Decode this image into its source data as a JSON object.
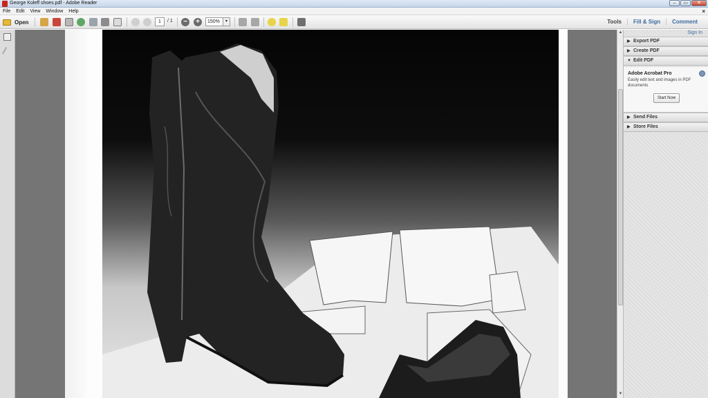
{
  "window": {
    "title": "George Koleff shoes.pdf - Adobe Reader",
    "controls": {
      "minimize": "–",
      "maximize": "▭",
      "close": "✕"
    }
  },
  "menubar": {
    "items": [
      "File",
      "Edit",
      "View",
      "Window",
      "Help"
    ],
    "close_doc": "×"
  },
  "toolbar": {
    "open_label": "Open",
    "page_current": "1",
    "page_total": "/ 1",
    "zoom_value": "150%",
    "zoom_dropdown": "▾",
    "zoom_out": "−",
    "zoom_in": "+",
    "right_links": [
      "Tools",
      "Fill & Sign",
      "Comment"
    ]
  },
  "right_pane": {
    "sign_in": "Sign In",
    "panels": [
      {
        "label": "Export PDF",
        "state": "collapsed",
        "arrow": "▶"
      },
      {
        "label": "Create PDF",
        "state": "collapsed",
        "arrow": "▶"
      },
      {
        "label": "Edit PDF",
        "state": "expanded",
        "arrow": "▼"
      },
      {
        "label": "Send Files",
        "state": "collapsed",
        "arrow": "▶"
      },
      {
        "label": "Store Files",
        "state": "collapsed",
        "arrow": "▶"
      }
    ],
    "edit_pdf": {
      "product": "Adobe Acrobat Pro",
      "description": "Easily edit text and images in PDF documents",
      "button": "Start Now"
    }
  },
  "colors": {
    "doc_background": "#757575",
    "link_blue": "#3b6a9f",
    "title_bar": "#c6d6ea"
  }
}
